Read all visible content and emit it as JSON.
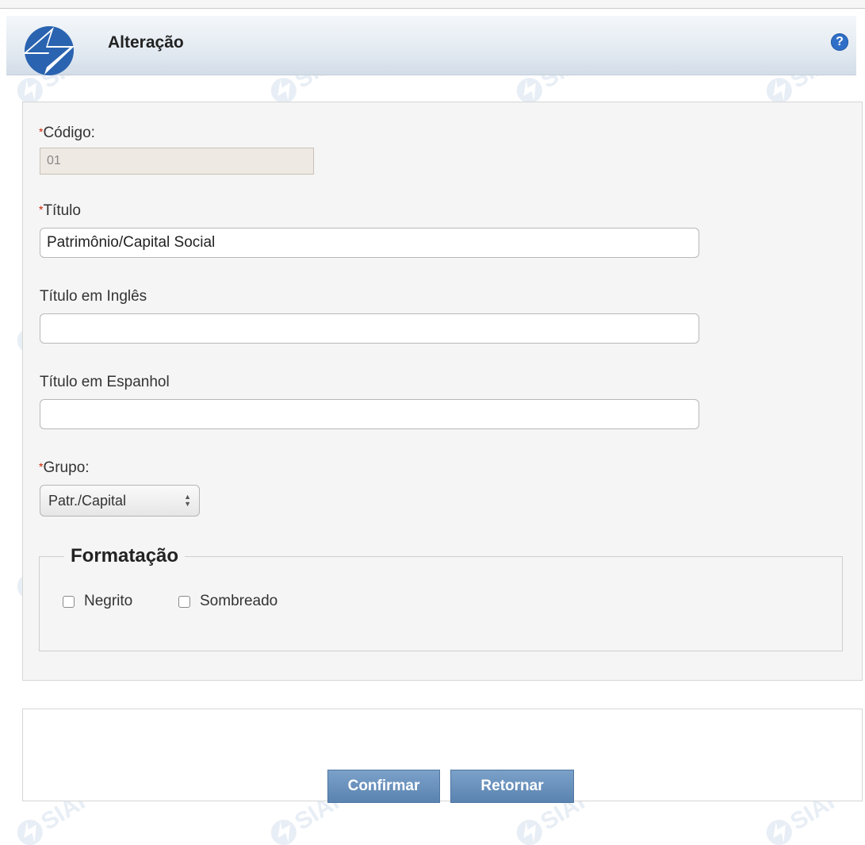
{
  "header": {
    "title": "Alteração",
    "help_symbol": "?"
  },
  "form": {
    "codigo": {
      "label": "Código:",
      "required_mark": "*",
      "value": "01"
    },
    "titulo": {
      "label": "Título",
      "required_mark": "*",
      "value": "Patrimônio/Capital Social"
    },
    "titulo_ingles": {
      "label": "Título em Inglês",
      "value": ""
    },
    "titulo_espanhol": {
      "label": "Título em Espanhol",
      "value": ""
    },
    "grupo": {
      "label": "Grupo:",
      "required_mark": "*",
      "selected": "Patr./Capital"
    },
    "formatacao": {
      "legend": "Formatação",
      "negrito_label": "Negrito",
      "sombreado_label": "Sombreado",
      "negrito_checked": false,
      "sombreado_checked": false
    }
  },
  "actions": {
    "confirm_label": "Confirmar",
    "return_label": "Retornar"
  },
  "colors": {
    "required": "#cc2200",
    "button": "#6a91bd",
    "help_icon": "#2f6fc7"
  },
  "icons": [
    "siafi-logo-icon",
    "help-icon",
    "spinner-arrows-icon",
    "watermark-siafi-icon"
  ]
}
